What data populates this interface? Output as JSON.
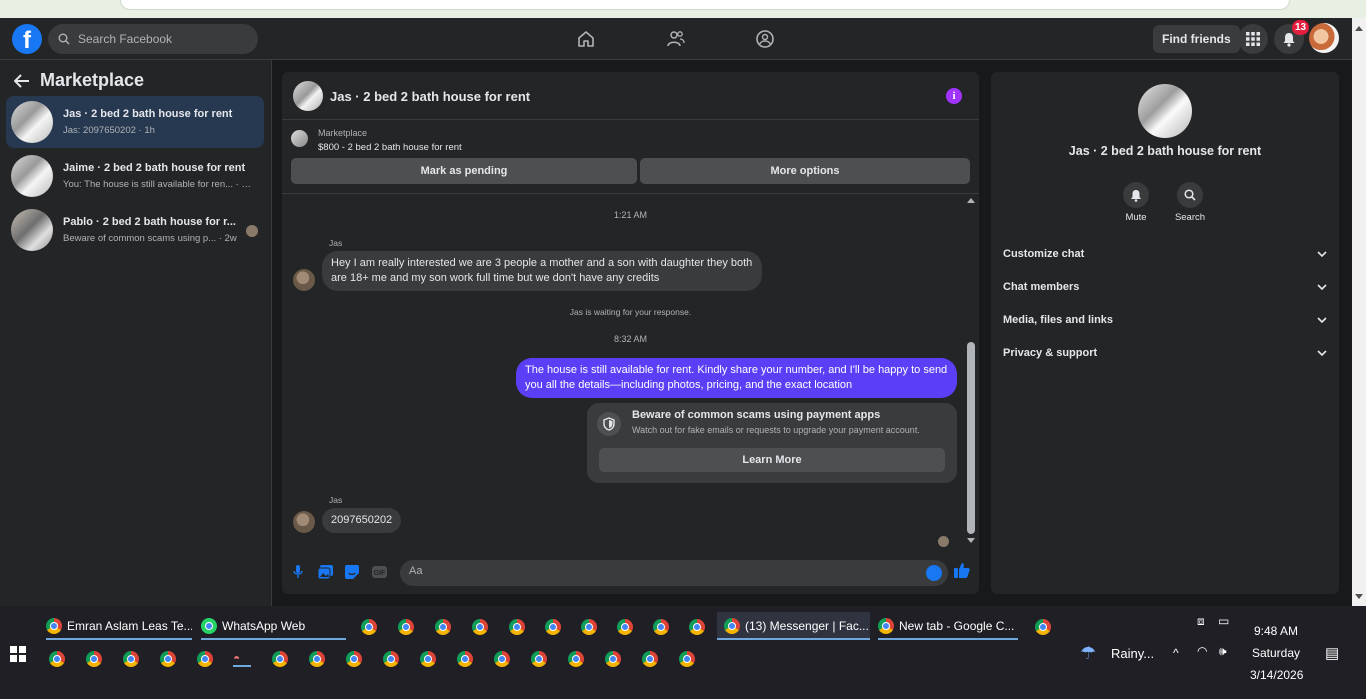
{
  "topnav": {
    "logo": "f",
    "search_placeholder": "Search Facebook",
    "find_friends": "Find friends",
    "notifications_count": "13"
  },
  "sidebar": {
    "title": "Marketplace",
    "conversations": [
      {
        "name": "Jas · 2 bed 2 bath house for rent",
        "preview": "Jas: 2097650202 · 1h",
        "active": true
      },
      {
        "name": "Jaime · 2 bed 2 bath house for rent",
        "preview": "You: The house is still available for ren... · 2w",
        "active": false
      },
      {
        "name": "Pablo · 2 bed 2 bath house for r...",
        "preview": "Beware of common scams using p... · 2w",
        "active": false
      }
    ]
  },
  "chat": {
    "title": "Jas · 2 bed 2 bath house for rent",
    "listing_kind": "Marketplace",
    "listing_price": "$800 - 2 bed 2 bath house for rent",
    "mark_pending": "Mark as pending",
    "more_options": "More options",
    "time1": "1:21 AM",
    "sender1": "Jas",
    "msg1": "Hey I am really interested we are 3 people a mother and a son with daughter they both are 18+ me and my son work full time but we don't have any credits",
    "waiting": "Jas is waiting for your response.",
    "time2": "8:32 AM",
    "msg_out": "The house is still available for rent. Kindly share your number, and I'll be happy to send you all the details—including photos, pricing, and the exact location",
    "warn_title": "Beware of common scams using payment apps",
    "warn_sub": "Watch out for fake emails or requests to upgrade your payment account.",
    "learn_more": "Learn More",
    "sender2": "Jas",
    "msg2": "2097650202",
    "composer_placeholder": "Aa"
  },
  "details": {
    "title": "Jas · 2 bed 2 bath house for rent",
    "mute": "Mute",
    "search": "Search",
    "rows": [
      "Customize chat",
      "Chat members",
      "Media, files and links",
      "Privacy & support"
    ]
  },
  "taskbar": {
    "tabs": [
      "Emran Aslam Leas Te...",
      "WhatsApp Web",
      "(13) Messenger | Fac...",
      "New tab - Google C..."
    ],
    "weather": "Rainy...",
    "time": "9:48 AM",
    "day": "Saturday",
    "date": "3/14/2026"
  },
  "colors": {
    "accent": "#1877f2",
    "bubble_out": "#5b3ff6",
    "bg": "#18191a",
    "panel": "#242526"
  }
}
